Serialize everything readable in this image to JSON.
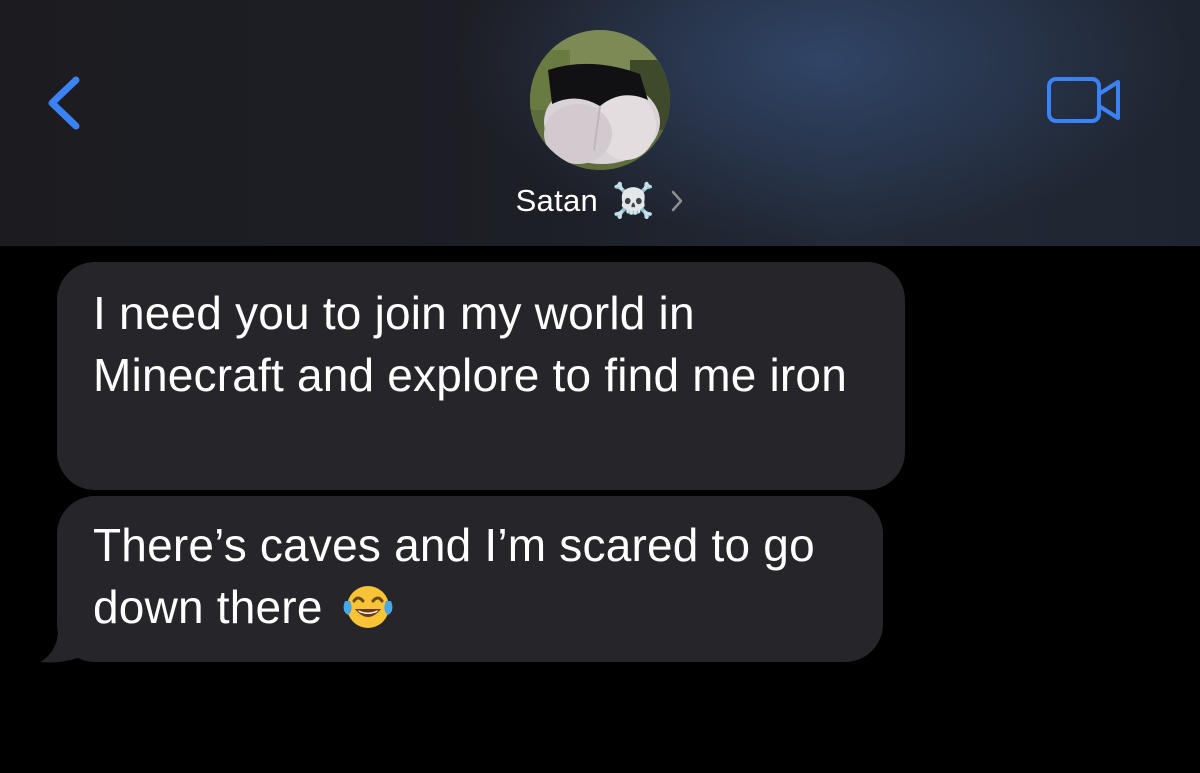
{
  "header": {
    "contact_name": "Satan",
    "contact_emoji": "☠️",
    "back_icon": "chevron-left-icon",
    "video_icon": "video-camera-icon",
    "accent_color": "#3b82f6"
  },
  "messages": [
    {
      "direction": "incoming",
      "text": "I need you to join my world in Minecraft and explore to find me iron"
    },
    {
      "direction": "incoming",
      "text": "There’s caves and I’m scared to go down there",
      "emoji": "😂"
    }
  ],
  "colors": {
    "background": "#000000",
    "bubble_incoming": "#26252a",
    "text": "#ffffff"
  }
}
